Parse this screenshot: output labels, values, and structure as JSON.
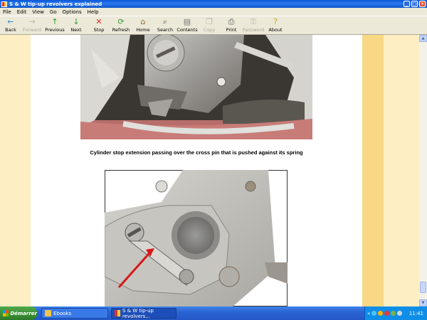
{
  "window": {
    "title": "S & W tip-up revolvers explained",
    "minimize": "_",
    "maximize": "□",
    "close": "×"
  },
  "menu": [
    "File",
    "Edit",
    "View",
    "Go",
    "Options",
    "Help"
  ],
  "toolbar": [
    {
      "label": "Back",
      "icon": "←",
      "color": "#2b8ad6",
      "enabled": true
    },
    {
      "label": "Forward",
      "icon": "→",
      "color": "#b8b5a8",
      "enabled": false
    },
    {
      "label": "Previous",
      "icon": "↑",
      "color": "#2c9b2c",
      "enabled": true
    },
    {
      "label": "Next",
      "icon": "↓",
      "color": "#2c9b2c",
      "enabled": true
    },
    {
      "label": "Stop",
      "icon": "✕",
      "color": "#d62b2b",
      "enabled": true
    },
    {
      "label": "Refresh",
      "icon": "⟳",
      "color": "#3c9a3c",
      "enabled": true
    },
    {
      "label": "Home",
      "icon": "⌂",
      "color": "#8a6a2a",
      "enabled": true
    },
    {
      "label": "Search",
      "icon": "⌕",
      "color": "#555555",
      "enabled": true
    },
    {
      "label": "Contents",
      "icon": "▤",
      "color": "#777777",
      "enabled": true
    },
    {
      "label": "Copy",
      "icon": "❐",
      "color": "#b8b5a8",
      "enabled": false
    },
    {
      "label": "Print",
      "icon": "⎙",
      "color": "#555555",
      "enabled": true
    },
    {
      "label": "Password",
      "icon": "⚿",
      "color": "#b8b5a8",
      "enabled": false
    },
    {
      "label": "About",
      "icon": "?",
      "color": "#c9a227",
      "enabled": true
    }
  ],
  "content": {
    "caption": "Cylinder stop extension passing over the cross pin that is pushed against its spring"
  },
  "taskbar": {
    "start_label": "Démarrer",
    "tasks": [
      {
        "label": "Ebooks"
      },
      {
        "label": "S & W tip-up revolvers..."
      }
    ],
    "tray_arrow": "«",
    "clock": "11:41"
  },
  "colors": {
    "side_stripe": "#fdeec4",
    "right_band": "#f8d884",
    "titlebar": "#0a58d6",
    "arrow": "#d81818"
  }
}
